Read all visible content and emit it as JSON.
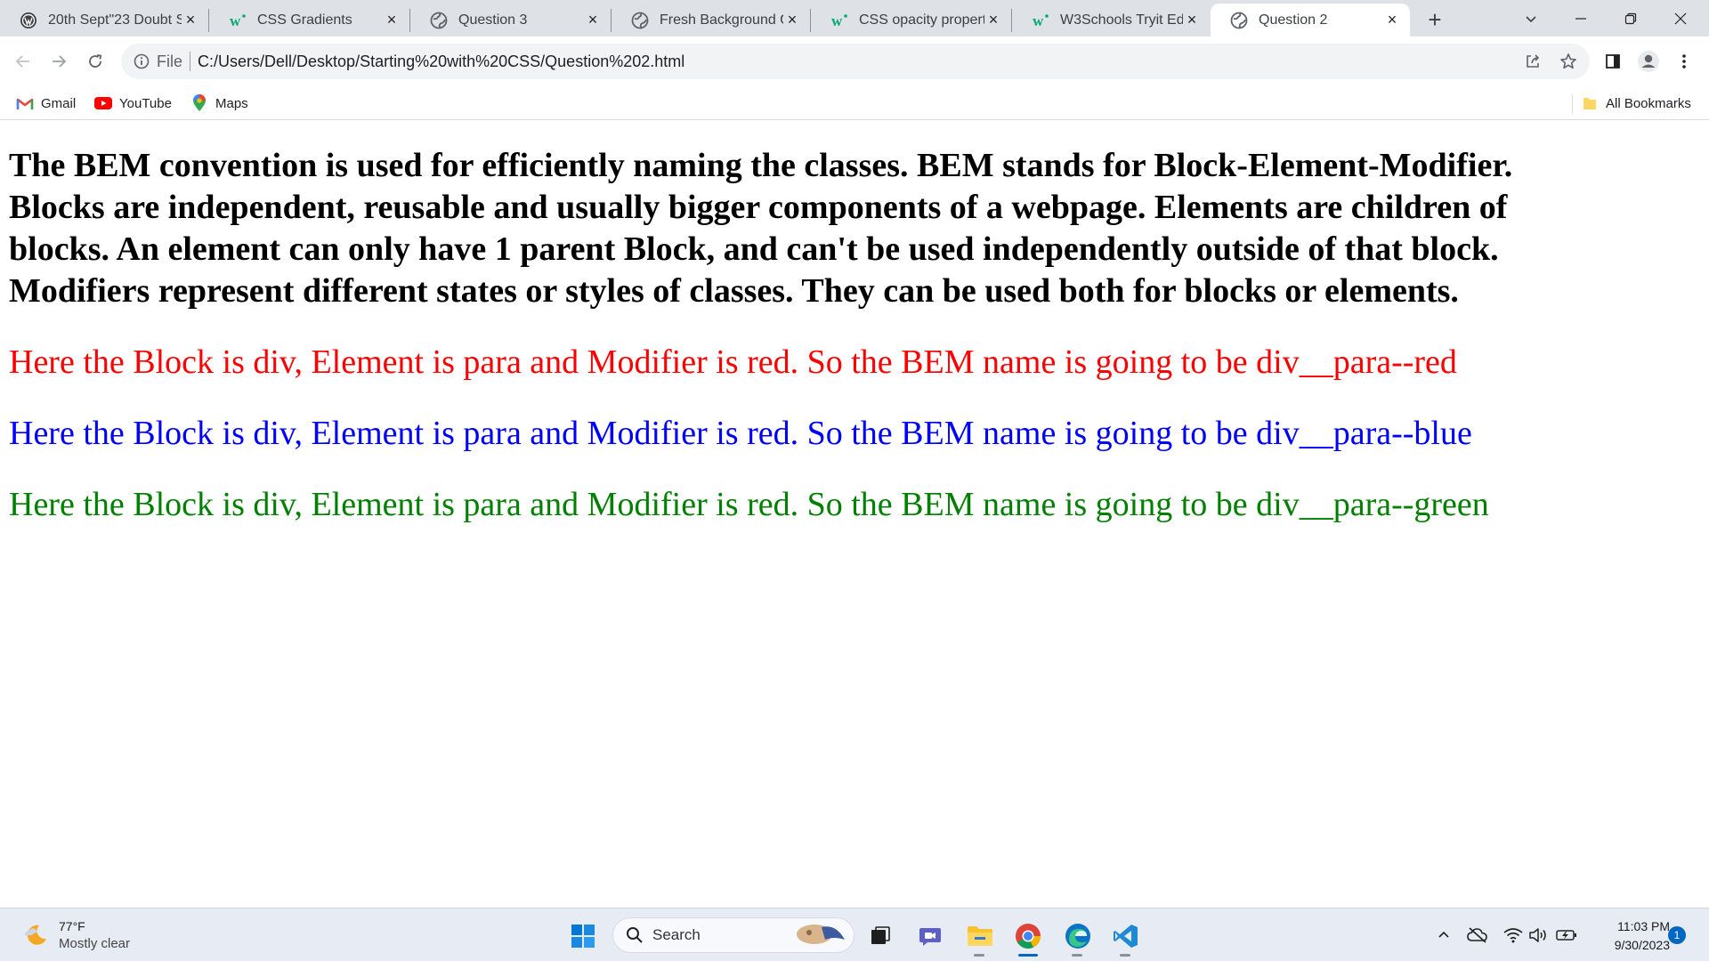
{
  "browser": {
    "tabs": [
      {
        "title": "20th Sept\"23 Doubt S",
        "icon": "wordpress-icon"
      },
      {
        "title": "CSS Gradients",
        "icon": "w3schools-icon"
      },
      {
        "title": "Question 3",
        "icon": "globe-icon"
      },
      {
        "title": "Fresh Background Gr",
        "icon": "globe-icon"
      },
      {
        "title": "CSS opacity property",
        "icon": "w3schools-icon"
      },
      {
        "title": "W3Schools Tryit Edito",
        "icon": "w3schools-icon"
      },
      {
        "title": "Question 2",
        "icon": "globe-icon",
        "active": true
      }
    ],
    "omnibox": {
      "scheme": "File",
      "url": "C:/Users/Dell/Desktop/Starting%20with%20CSS/Question%202.html"
    },
    "bookmarks": [
      {
        "label": "Gmail",
        "icon": "gmail-icon"
      },
      {
        "label": "YouTube",
        "icon": "youtube-icon"
      },
      {
        "label": "Maps",
        "icon": "maps-icon"
      }
    ],
    "all_bookmarks": "All Bookmarks"
  },
  "page": {
    "heading": "The BEM convention is used for efficiently naming the classes. BEM stands for Block-Element-Modifier. Blocks are independent, reusable and usually bigger components of a webpage. Elements are children of blocks. An element can only have 1 parent Block, and can't be used independently outside of that block. Modifiers represent different states or styles of classes. They can be used both for blocks or elements.",
    "paragraphs": [
      {
        "text": "Here the Block is div, Element is para and Modifier is red. So the BEM name is going to be div__para--red",
        "color": "#ff0000"
      },
      {
        "text": "Here the Block is div, Element is para and Modifier is red. So the BEM name is going to be div__para--blue",
        "color": "#0000ff"
      },
      {
        "text": "Here the Block is div, Element is para and Modifier is red. So the BEM name is going to be div__para--green",
        "color": "#008000"
      }
    ]
  },
  "taskbar": {
    "weather": {
      "temp": "77°F",
      "condition": "Mostly clear"
    },
    "search_placeholder": "Search",
    "clock": {
      "time": "11:03 PM",
      "date": "9/30/2023"
    },
    "notification_count": "1"
  }
}
